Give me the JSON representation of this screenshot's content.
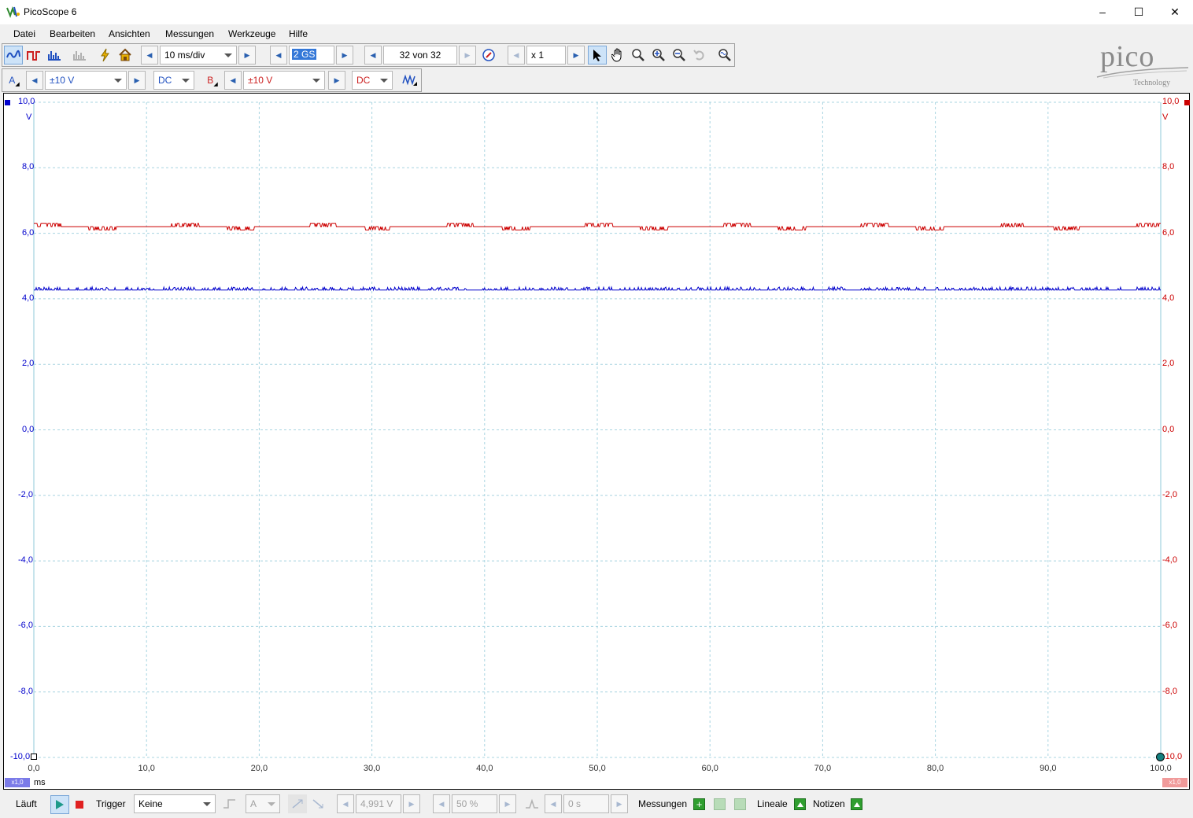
{
  "window": {
    "title": "PicoScope 6",
    "controls": {
      "minimize": "–",
      "maximize": "☐",
      "close": "✕"
    }
  },
  "menu": [
    "Datei",
    "Bearbeiten",
    "Ansichten",
    "Messungen",
    "Werkzeuge",
    "Hilfe"
  ],
  "toolbar": {
    "timebase": "10 ms/div",
    "samples": "2 GS",
    "buffer": "32 von 32",
    "zoom": "x 1"
  },
  "logo": {
    "text": "pico",
    "sub": "Technology"
  },
  "channels": {
    "a": {
      "label": "A",
      "range": "±10 V",
      "coupling": "DC",
      "color": "#0000cc"
    },
    "b": {
      "label": "B",
      "range": "±10 V",
      "coupling": "DC",
      "color": "#cc0000"
    }
  },
  "chart_data": {
    "type": "line",
    "xlabel": "ms",
    "ylabel": "V",
    "x_range": [
      0,
      100
    ],
    "y_range": [
      -10,
      10
    ],
    "x_ticks": [
      "0,0",
      "10,0",
      "20,0",
      "30,0",
      "40,0",
      "50,0",
      "60,0",
      "70,0",
      "80,0",
      "90,0",
      "100,0"
    ],
    "y_ticks": [
      "10,0",
      "8,0",
      "6,0",
      "4,0",
      "2,0",
      "0,0",
      "-2,0",
      "-4,0",
      "-6,0",
      "-8,0",
      "-10,0"
    ],
    "grid": true,
    "series": [
      {
        "name": "A",
        "color": "#0000cc",
        "level": 4.27,
        "noise": 0.06
      },
      {
        "name": "B",
        "color": "#cc0000",
        "level": 6.2,
        "noise": 0.1
      }
    ],
    "scale_a": "x1,0",
    "scale_b": "x1,0"
  },
  "status": {
    "run_label": "Läuft",
    "trigger_label": "Trigger",
    "trigger_mode": "Keine",
    "trigger_channel": "A",
    "trigger_level": "4,991 V",
    "pretrigger": "50 %",
    "delay": "0 s",
    "measurements": "Messungen",
    "rulers": "Lineale",
    "notes": "Notizen"
  }
}
